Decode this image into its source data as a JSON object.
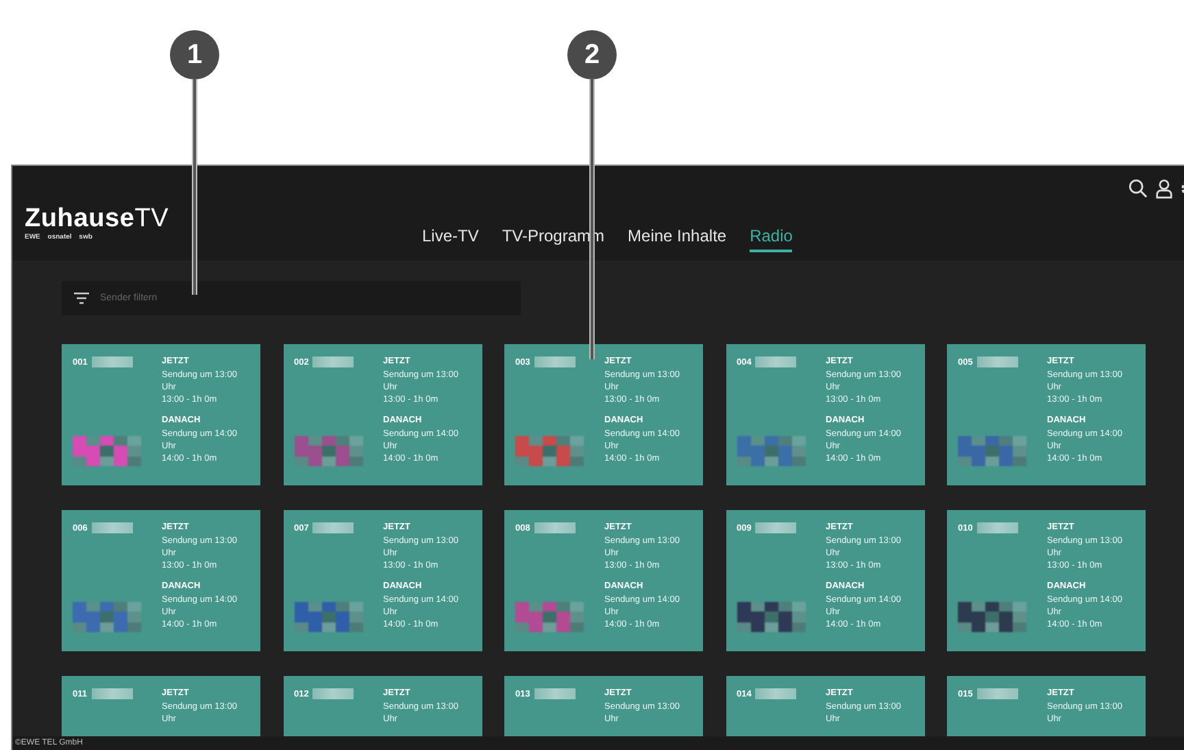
{
  "callouts": [
    {
      "label": "1"
    },
    {
      "label": "2"
    }
  ],
  "header": {
    "logo": "**Zuhause**TV",
    "logo_partners": "EWE osnatel swb",
    "tabs": [
      {
        "label": "Live-TV",
        "selected": false
      },
      {
        "label": "TV-Programm",
        "selected": false
      },
      {
        "label": "Meine Inhalte",
        "selected": false
      },
      {
        "label": "Radio",
        "selected": true
      }
    ]
  },
  "filter": {
    "placeholder": "Sender filtern"
  },
  "cards": [
    {
      "number": "001",
      "color": "#d64bb4",
      "now_label": "JETZT",
      "now_title": "Sendung um 13:00 Uhr",
      "now_time": "13:00 - 1h 0m",
      "next_label": "DANACH",
      "next_title": "Sendung um 14:00 Uhr",
      "next_time": "14:00 - 1h 0m"
    },
    {
      "number": "002",
      "color": "#9b4f8e",
      "now_label": "JETZT",
      "now_title": "Sendung um 13:00 Uhr",
      "now_time": "13:00 - 1h 0m",
      "next_label": "DANACH",
      "next_title": "Sendung um 14:00 Uhr",
      "next_time": "14:00 - 1h 0m"
    },
    {
      "number": "003",
      "color": "#c84a4a",
      "now_label": "JETZT",
      "now_title": "Sendung um 13:00 Uhr",
      "now_time": "13:00 - 1h 0m",
      "next_label": "DANACH",
      "next_title": "Sendung um 14:00 Uhr",
      "next_time": "14:00 - 1h 0m"
    },
    {
      "number": "004",
      "color": "#3b6fa8",
      "now_label": "JETZT",
      "now_title": "Sendung um 13:00 Uhr",
      "now_time": "13:00 - 1h 0m",
      "next_label": "DANACH",
      "next_title": "Sendung um 14:00 Uhr",
      "next_time": "14:00 - 1h 0m"
    },
    {
      "number": "005",
      "color": "#3a68a6",
      "now_label": "JETZT",
      "now_title": "Sendung um 13:00 Uhr",
      "now_time": "13:00 - 1h 0m",
      "next_label": "DANACH",
      "next_title": "Sendung um 14:00 Uhr",
      "next_time": "14:00 - 1h 0m"
    },
    {
      "number": "006",
      "color": "#3d6bb0",
      "now_label": "JETZT",
      "now_title": "Sendung um 13:00 Uhr",
      "now_time": "13:00 - 1h 0m",
      "next_label": "DANACH",
      "next_title": "Sendung um 14:00 Uhr",
      "next_time": "14:00 - 1h 0m"
    },
    {
      "number": "007",
      "color": "#2f5fa8",
      "now_label": "JETZT",
      "now_title": "Sendung um 13:00 Uhr",
      "now_time": "13:00 - 1h 0m",
      "next_label": "DANACH",
      "next_title": "Sendung um 14:00 Uhr",
      "next_time": "14:00 - 1h 0m"
    },
    {
      "number": "008",
      "color": "#b34a94",
      "now_label": "JETZT",
      "now_title": "Sendung um 13:00 Uhr",
      "now_time": "13:00 - 1h 0m",
      "next_label": "DANACH",
      "next_title": "Sendung um 14:00 Uhr",
      "next_time": "14:00 - 1h 0m"
    },
    {
      "number": "009",
      "color": "#2e3a55",
      "now_label": "JETZT",
      "now_title": "Sendung um 13:00 Uhr",
      "now_time": "13:00 - 1h 0m",
      "next_label": "DANACH",
      "next_title": "Sendung um 14:00 Uhr",
      "next_time": "14:00 - 1h 0m"
    },
    {
      "number": "010",
      "color": "#2d3b4f",
      "now_label": "JETZT",
      "now_title": "Sendung um 13:00 Uhr",
      "now_time": "13:00 - 1h 0m",
      "next_label": "DANACH",
      "next_title": "Sendung um 14:00 Uhr",
      "next_time": "14:00 - 1h 0m"
    },
    {
      "number": "011",
      "now_label": "JETZT",
      "now_title": "Sendung um 13:00 Uhr"
    },
    {
      "number": "012",
      "now_label": "JETZT",
      "now_title": "Sendung um 13:00 Uhr"
    },
    {
      "number": "013",
      "now_label": "JETZT",
      "now_title": "Sendung um 13:00 Uhr"
    },
    {
      "number": "014",
      "now_label": "JETZT",
      "now_title": "Sendung um 13:00 Uhr"
    },
    {
      "number": "015",
      "now_label": "JETZT",
      "now_title": "Sendung um 13:00 Uhr"
    }
  ],
  "footer": {
    "copyright": "©EWE TEL GmbH"
  }
}
